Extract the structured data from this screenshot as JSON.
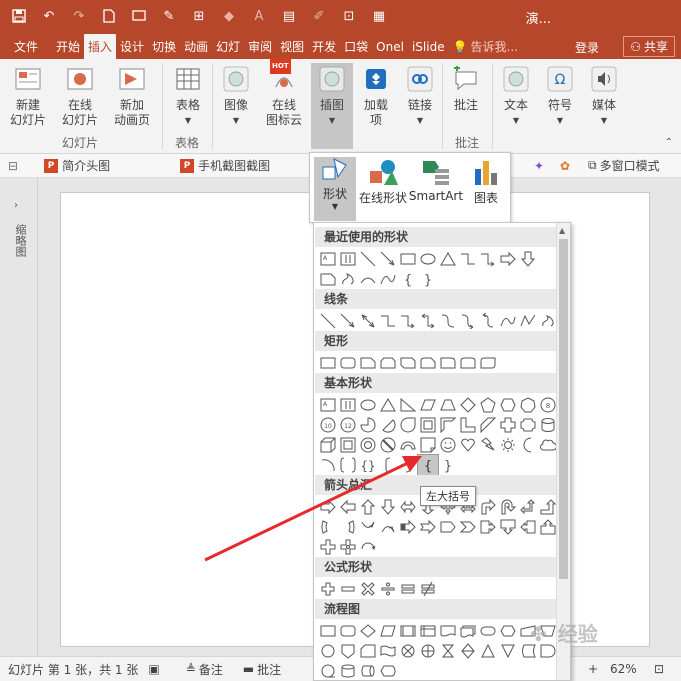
{
  "window": {
    "title": "演..."
  },
  "qat": {
    "icons": [
      "save-icon",
      "undo-icon",
      "redo-icon",
      "new-file-icon",
      "slideshow-icon",
      "eyedropper-icon",
      "align-icon",
      "fill-icon",
      "font-color-icon",
      "clipboard-icon",
      "brush-icon",
      "select-icon",
      "theme-icon"
    ]
  },
  "tabs": [
    {
      "label": "文件"
    },
    {
      "label": "开始"
    },
    {
      "label": "插入"
    },
    {
      "label": "设计"
    },
    {
      "label": "切换"
    },
    {
      "label": "动画"
    },
    {
      "label": "幻灯"
    },
    {
      "label": "审阅"
    },
    {
      "label": "视图"
    },
    {
      "label": "开发"
    },
    {
      "label": "口袋"
    },
    {
      "label": "Onel"
    },
    {
      "label": "iSlide"
    },
    {
      "label": "告诉我..."
    }
  ],
  "account": {
    "login": "登录",
    "share": "共享"
  },
  "ribbon": {
    "new_slide": "新建\n幻灯片",
    "online_slide": "在线\n幻灯片",
    "new_anim": "新加\n动画页",
    "table": "表格",
    "image": "图像",
    "online_icon": "在线\n图标云",
    "hot": "HOT",
    "illustration": "插图",
    "addins": "加载\n项",
    "link": "链接",
    "comment": "批注",
    "text": "文本",
    "symbol": "符号",
    "media": "媒体",
    "group_slides": "幻灯片",
    "group_table": "表格",
    "group_comment": "批注"
  },
  "addinbar": {
    "item1": "简介头图",
    "item2": "手机截图截图",
    "multiwindow": "多窗口模式"
  },
  "left_pane": {
    "label": "缩略图"
  },
  "illus_menu": {
    "shapes": "形状",
    "online_shapes": "在线形状",
    "smartart": "SmartArt",
    "chart": "图表"
  },
  "shapes_gallery": {
    "categories": [
      "最近使用的形状",
      "线条",
      "矩形",
      "基本形状",
      "箭头总汇",
      "公式形状",
      "流程图"
    ],
    "tooltip": "左大括号"
  },
  "status": {
    "slide_info": "幻灯片 第 1 张，共 1 张",
    "notes": "备注",
    "comments": "批注",
    "zoom": "62%"
  },
  "watermark": "经验",
  "colors": {
    "accent": "#b7472a",
    "ribbon": "#f3f3f3"
  }
}
